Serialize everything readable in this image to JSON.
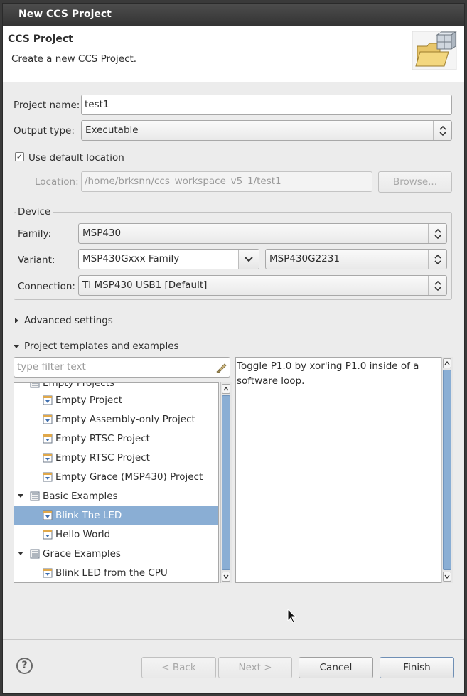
{
  "window": {
    "title": "New CCS Project"
  },
  "header": {
    "title": "CCS Project",
    "description": "Create a new CCS Project."
  },
  "project": {
    "name_label": "Project name:",
    "name_value": "test1",
    "output_label": "Output type:",
    "output_value": "Executable",
    "default_location_label": "Use default location",
    "default_location_checked": true,
    "location_label": "Location:",
    "location_value": "/home/brksnn/ccs_workspace_v5_1/test1",
    "browse_label": "Browse..."
  },
  "device": {
    "group_label": "Device",
    "family_label": "Family:",
    "family_value": "MSP430",
    "variant_label": "Variant:",
    "variant_family_value": "MSP430Gxxx Family",
    "variant_value": "MSP430G2231",
    "connection_label": "Connection:",
    "connection_value": "TI MSP430 USB1 [Default]"
  },
  "advanced": {
    "label": "Advanced settings"
  },
  "templates": {
    "label": "Project templates and examples",
    "filter_placeholder": "type filter text",
    "items": [
      {
        "label": "Empty Projects"
      },
      {
        "label": "Empty Project"
      },
      {
        "label": "Empty Assembly-only Project"
      },
      {
        "label": "Empty RTSC Project"
      },
      {
        "label": "Empty RTSC Project"
      },
      {
        "label": "Empty Grace (MSP430) Project"
      },
      {
        "label": "Basic Examples"
      },
      {
        "label": "Blink The LED"
      },
      {
        "label": "Hello World"
      },
      {
        "label": "Grace Examples"
      },
      {
        "label": "Blink LED from the CPU"
      }
    ],
    "description": "Toggle P1.0 by xor'ing P1.0 inside of a software loop."
  },
  "buttons": {
    "help": "?",
    "back": "< Back",
    "next": "Next >",
    "cancel": "Cancel",
    "finish": "Finish"
  },
  "colors": {
    "selection": "#8aaed4",
    "titlebar": "#3d3d3d"
  }
}
